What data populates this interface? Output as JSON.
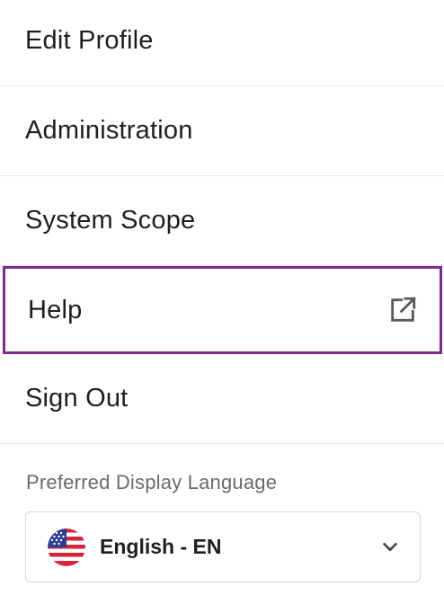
{
  "menu": {
    "items": [
      {
        "label": "Edit Profile"
      },
      {
        "label": "Administration"
      },
      {
        "label": "System Scope"
      },
      {
        "label": "Help",
        "icon": "external-link-icon",
        "focused": true
      },
      {
        "label": "Sign Out"
      }
    ]
  },
  "language": {
    "label": "Preferred Display Language",
    "selected": "English - EN",
    "flag_icon": "us-flag-icon",
    "dropdown_icon": "chevron-down-icon"
  },
  "colors": {
    "focus_outline": "#7b2d8b",
    "divider": "#e6e6e6",
    "muted_text": "#6b6b6b"
  }
}
